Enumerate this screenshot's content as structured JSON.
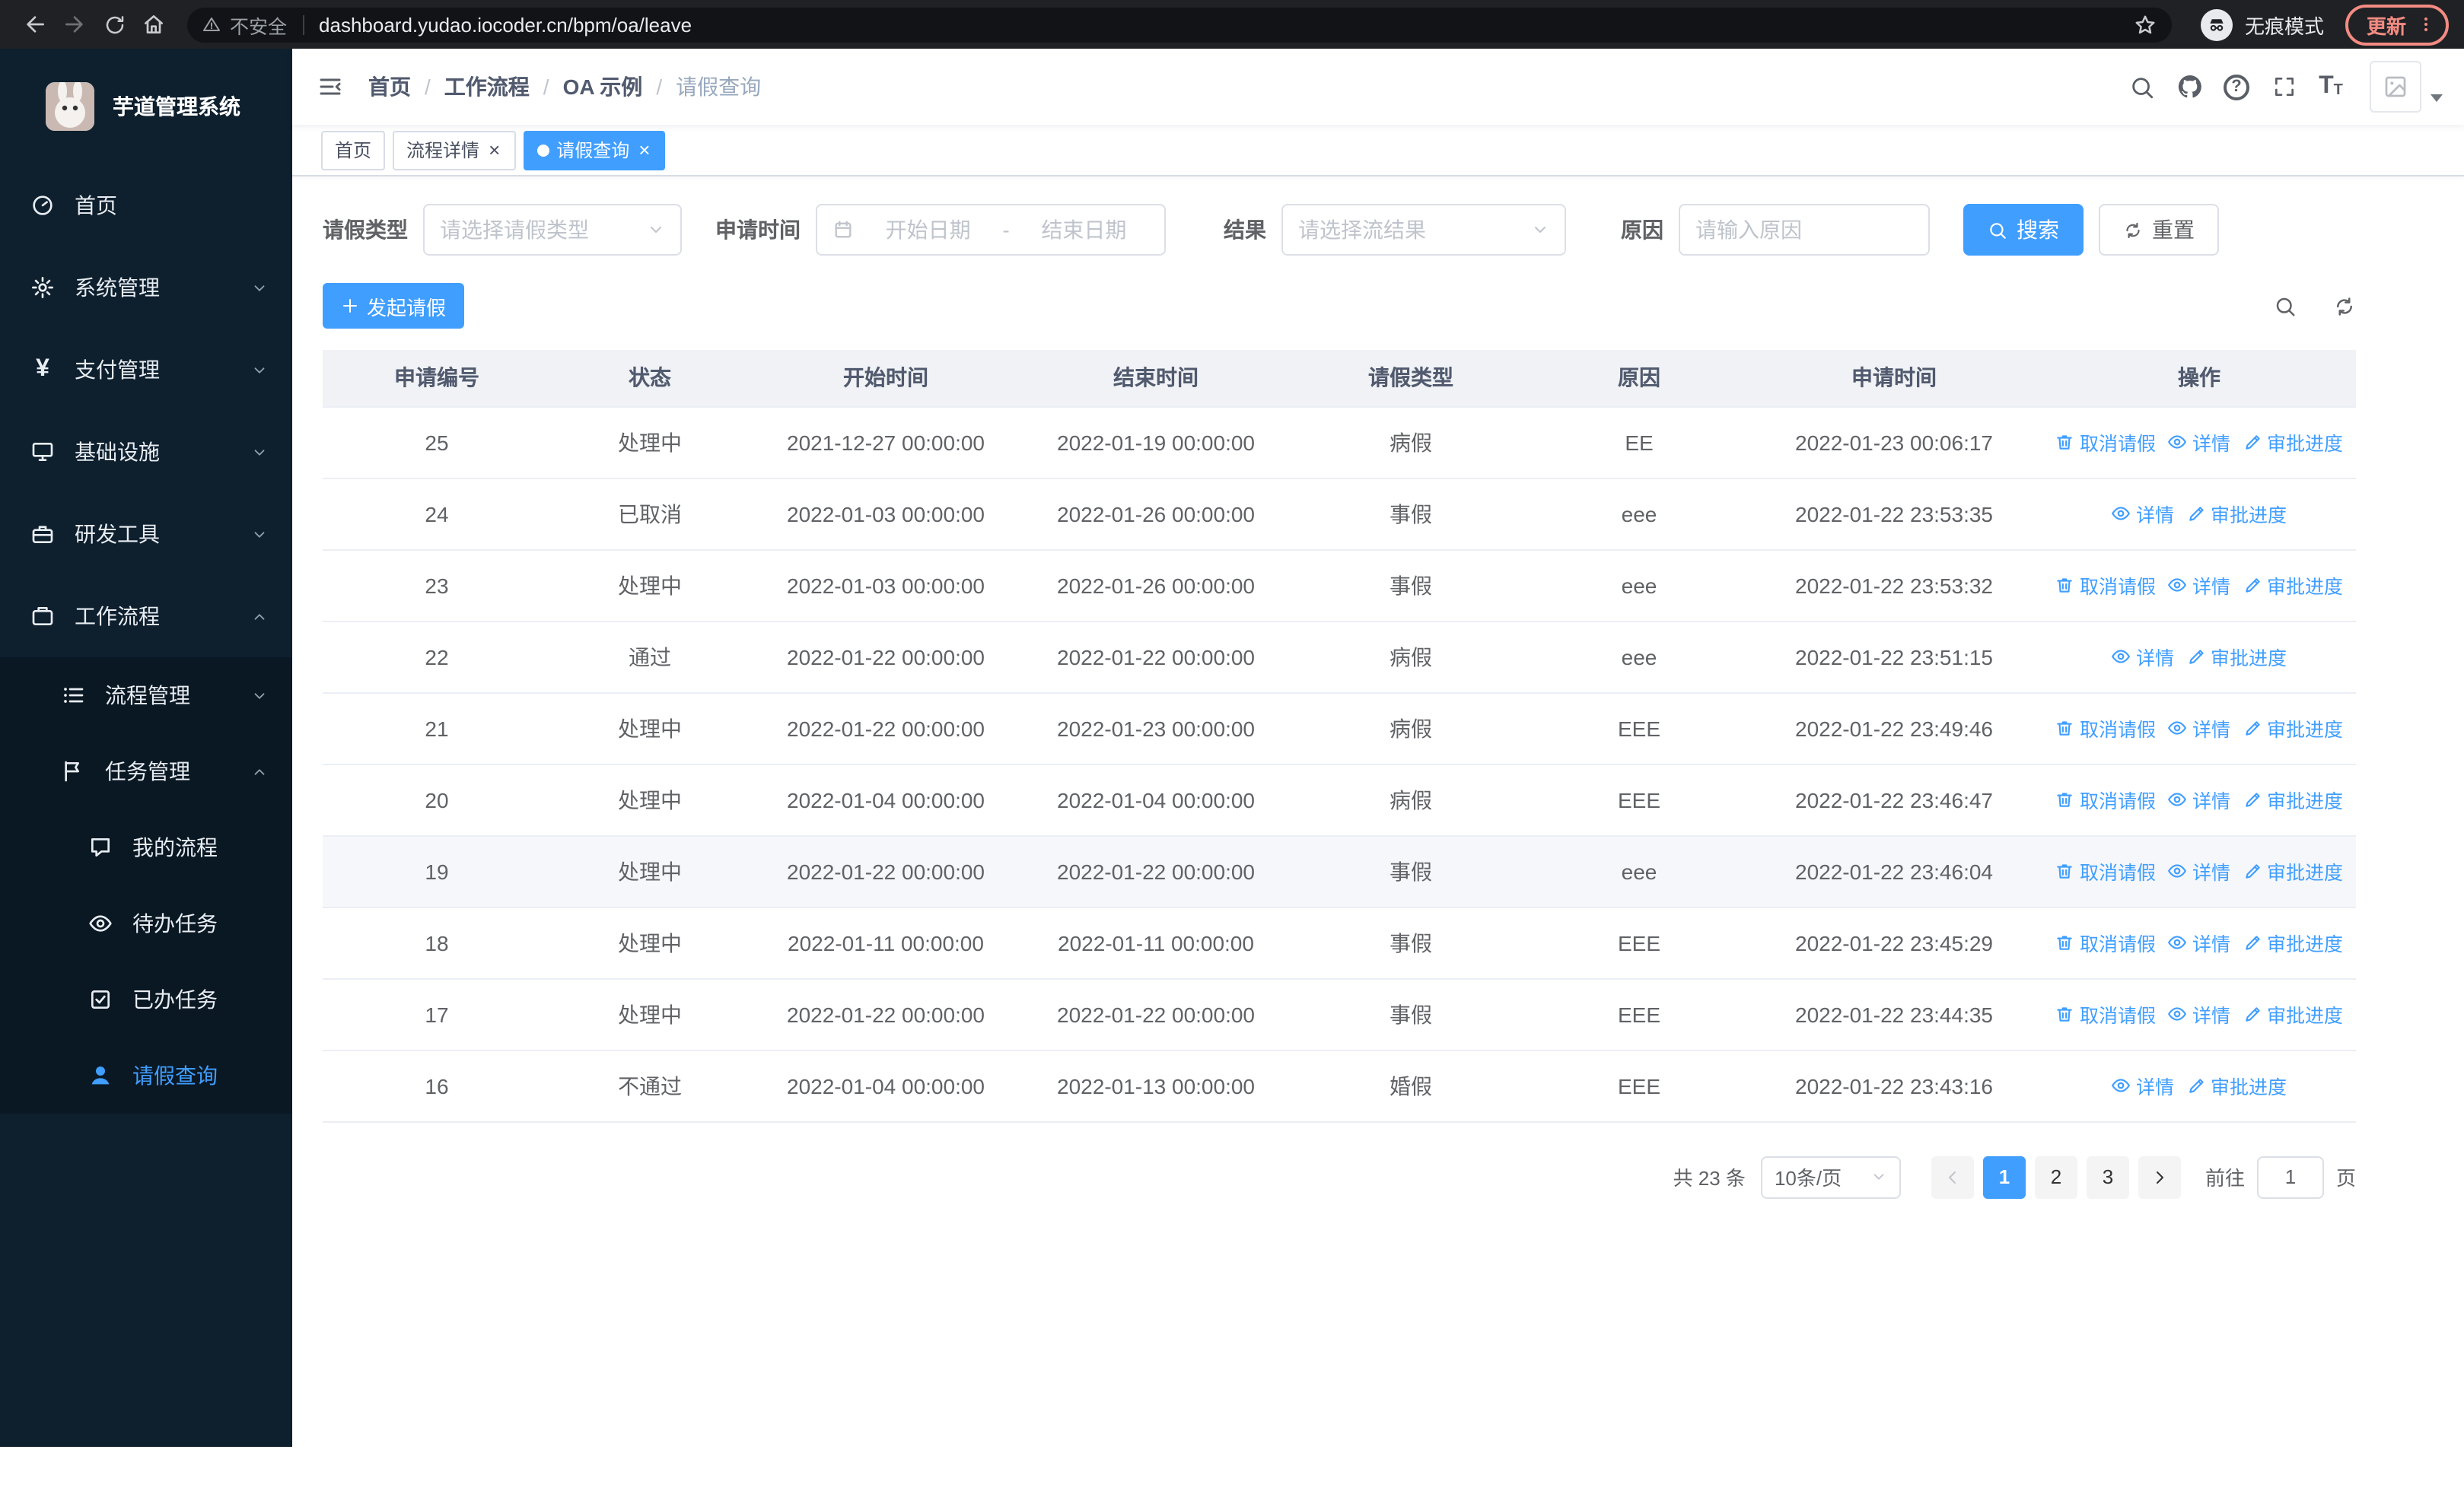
{
  "browser": {
    "security_label": "不安全",
    "url": "dashboard.yudao.iocoder.cn/bpm/oa/leave",
    "incognito_label": "无痕模式",
    "update_label": "更新"
  },
  "glyphs": {
    "yen": "¥",
    "font_size": "T",
    "question": "?",
    "close": "×",
    "separator": "/"
  },
  "sidebar": {
    "logo_title": "芋道管理系统",
    "items": [
      {
        "label": "首页"
      },
      {
        "label": "系统管理"
      },
      {
        "label": "支付管理"
      },
      {
        "label": "基础设施"
      },
      {
        "label": "研发工具"
      },
      {
        "label": "工作流程"
      }
    ],
    "submenu": [
      {
        "label": "流程管理"
      },
      {
        "label": "任务管理"
      }
    ],
    "tasks_children": [
      {
        "label": "我的流程"
      },
      {
        "label": "待办任务"
      },
      {
        "label": "已办任务"
      },
      {
        "label": "请假查询"
      }
    ]
  },
  "header": {
    "breadcrumb": [
      "首页",
      "工作流程",
      "OA 示例",
      "请假查询"
    ]
  },
  "tabs": [
    {
      "label": "首页"
    },
    {
      "label": "流程详情"
    },
    {
      "label": "请假查询"
    }
  ],
  "filters": {
    "leave_type_label": "请假类型",
    "leave_type_placeholder": "请选择请假类型",
    "apply_time_label": "申请时间",
    "start_date_placeholder": "开始日期",
    "date_separator": "-",
    "end_date_placeholder": "结束日期",
    "result_label": "结果",
    "result_placeholder": "请选择流结果",
    "reason_label": "原因",
    "reason_placeholder": "请输入原因",
    "search_button": "搜索",
    "reset_button": "重置"
  },
  "toolbar": {
    "create_button": "发起请假"
  },
  "table": {
    "columns": [
      "申请编号",
      "状态",
      "开始时间",
      "结束时间",
      "请假类型",
      "原因",
      "申请时间",
      "操作"
    ],
    "action_labels": {
      "cancel": "取消请假",
      "detail": "详情",
      "progress": "审批进度"
    },
    "rows": [
      {
        "id": "25",
        "status": "处理中",
        "start": "2021-12-27 00:00:00",
        "end": "2022-01-19 00:00:00",
        "type": "病假",
        "reason": "EE",
        "apply_time": "2022-01-23 00:06:17",
        "actions": [
          "cancel",
          "detail",
          "progress"
        ],
        "highlight": false
      },
      {
        "id": "24",
        "status": "已取消",
        "start": "2022-01-03 00:00:00",
        "end": "2022-01-26 00:00:00",
        "type": "事假",
        "reason": "eee",
        "apply_time": "2022-01-22 23:53:35",
        "actions": [
          "detail",
          "progress"
        ],
        "highlight": false
      },
      {
        "id": "23",
        "status": "处理中",
        "start": "2022-01-03 00:00:00",
        "end": "2022-01-26 00:00:00",
        "type": "事假",
        "reason": "eee",
        "apply_time": "2022-01-22 23:53:32",
        "actions": [
          "cancel",
          "detail",
          "progress"
        ],
        "highlight": false
      },
      {
        "id": "22",
        "status": "通过",
        "start": "2022-01-22 00:00:00",
        "end": "2022-01-22 00:00:00",
        "type": "病假",
        "reason": "eee",
        "apply_time": "2022-01-22 23:51:15",
        "actions": [
          "detail",
          "progress"
        ],
        "highlight": false
      },
      {
        "id": "21",
        "status": "处理中",
        "start": "2022-01-22 00:00:00",
        "end": "2022-01-23 00:00:00",
        "type": "病假",
        "reason": "EEE",
        "apply_time": "2022-01-22 23:49:46",
        "actions": [
          "cancel",
          "detail",
          "progress"
        ],
        "highlight": false
      },
      {
        "id": "20",
        "status": "处理中",
        "start": "2022-01-04 00:00:00",
        "end": "2022-01-04 00:00:00",
        "type": "病假",
        "reason": "EEE",
        "apply_time": "2022-01-22 23:46:47",
        "actions": [
          "cancel",
          "detail",
          "progress"
        ],
        "highlight": false
      },
      {
        "id": "19",
        "status": "处理中",
        "start": "2022-01-22 00:00:00",
        "end": "2022-01-22 00:00:00",
        "type": "事假",
        "reason": "eee",
        "apply_time": "2022-01-22 23:46:04",
        "actions": [
          "cancel",
          "detail",
          "progress"
        ],
        "highlight": true
      },
      {
        "id": "18",
        "status": "处理中",
        "start": "2022-01-11 00:00:00",
        "end": "2022-01-11 00:00:00",
        "type": "事假",
        "reason": "EEE",
        "apply_time": "2022-01-22 23:45:29",
        "actions": [
          "cancel",
          "detail",
          "progress"
        ],
        "highlight": false
      },
      {
        "id": "17",
        "status": "处理中",
        "start": "2022-01-22 00:00:00",
        "end": "2022-01-22 00:00:00",
        "type": "事假",
        "reason": "EEE",
        "apply_time": "2022-01-22 23:44:35",
        "actions": [
          "cancel",
          "detail",
          "progress"
        ],
        "highlight": false
      },
      {
        "id": "16",
        "status": "不通过",
        "start": "2022-01-04 00:00:00",
        "end": "2022-01-13 00:00:00",
        "type": "婚假",
        "reason": "EEE",
        "apply_time": "2022-01-22 23:43:16",
        "actions": [
          "detail",
          "progress"
        ],
        "highlight": false
      }
    ]
  },
  "pagination": {
    "total": "共 23 条",
    "page_size": "10条/页",
    "pages": [
      "1",
      "2",
      "3"
    ],
    "active_page": "1",
    "goto_label": "前往",
    "goto_value": "1",
    "goto_suffix": "页"
  }
}
